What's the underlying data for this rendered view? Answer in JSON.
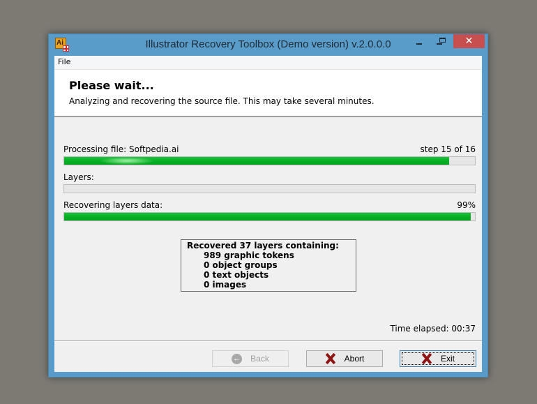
{
  "window": {
    "title": "Illustrator Recovery Toolbox (Demo version) v.2.0.0.0",
    "app_icon": "illustrator-recovery-icon",
    "app_icon_text": "Ai",
    "controls": {
      "minimize_icon": "minimize-icon",
      "maximize_icon": "maximize-icon",
      "close_label": "✕"
    }
  },
  "menu": {
    "items": [
      {
        "label": "File"
      }
    ]
  },
  "header": {
    "title": "Please wait...",
    "subtitle": "Analyzing and recovering the source file. This may take several minutes."
  },
  "progress": {
    "file": {
      "label": "Processing file: Softpedia.ai",
      "status": "step 15 of 16",
      "value": 0.9375
    },
    "layers": {
      "label": "Layers:",
      "status": "",
      "value": 0
    },
    "recovering": {
      "label": "Recovering layers data:",
      "status": "99%",
      "value": 0.99
    },
    "fill_color": "#06b025"
  },
  "stats": {
    "heading": "Recovered 37 layers containing:",
    "lines": [
      "989 graphic tokens",
      "0 object groups",
      "0 text objects",
      "0 images"
    ]
  },
  "time_elapsed": "Time elapsed: 00:37",
  "buttons": {
    "back": {
      "label": "Back",
      "icon": "back-arrow-icon",
      "glyph": "←",
      "enabled": false
    },
    "abort": {
      "label": "Abort",
      "icon": "red-x-icon",
      "enabled": true
    },
    "exit": {
      "label": "Exit",
      "icon": "red-x-icon",
      "enabled": true,
      "default": true
    }
  },
  "colors": {
    "titlebar": "#5a9cc9",
    "close_button": "#c74f4f",
    "progress_fill": "#06b025"
  }
}
